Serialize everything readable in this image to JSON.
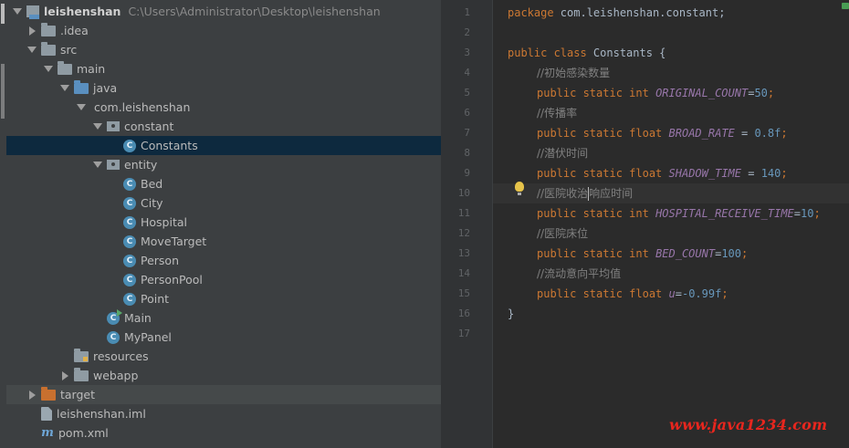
{
  "project_tree": {
    "rows": [
      {
        "label": "leishenshan",
        "path": "C:\\Users\\Administrator\\Desktop\\leishenshan",
        "icon": "module-icon"
      },
      {
        "label": ".idea",
        "icon": "folder-icon"
      },
      {
        "label": "src",
        "icon": "folder-icon"
      },
      {
        "label": "main",
        "icon": "folder-icon"
      },
      {
        "label": "java",
        "icon": "source-folder-icon"
      },
      {
        "label": "com.leishenshan",
        "icon": "package-icon"
      },
      {
        "label": "constant",
        "icon": "package-icon"
      },
      {
        "label": "Constants",
        "icon": "class-icon"
      },
      {
        "label": "entity",
        "icon": "package-icon"
      },
      {
        "label": "Bed",
        "icon": "class-icon"
      },
      {
        "label": "City",
        "icon": "class-icon"
      },
      {
        "label": "Hospital",
        "icon": "class-icon"
      },
      {
        "label": "MoveTarget",
        "icon": "class-icon"
      },
      {
        "label": "Person",
        "icon": "class-icon"
      },
      {
        "label": "PersonPool",
        "icon": "class-icon"
      },
      {
        "label": "Point",
        "icon": "class-icon"
      },
      {
        "label": "Main",
        "icon": "runnable-class-icon"
      },
      {
        "label": "MyPanel",
        "icon": "class-icon"
      },
      {
        "label": "resources",
        "icon": "resources-folder-icon"
      },
      {
        "label": "webapp",
        "icon": "folder-icon"
      },
      {
        "label": "target",
        "icon": "excluded-folder-icon"
      },
      {
        "label": "leishenshan.iml",
        "icon": "file-icon"
      },
      {
        "label": "pom.xml",
        "icon": "maven-icon"
      }
    ],
    "selected": "Constants",
    "class_icon_glyph": "C",
    "maven_icon_glyph": "m"
  },
  "editor": {
    "line_numbers": [
      "1",
      "2",
      "3",
      "4",
      "5",
      "6",
      "7",
      "8",
      "9",
      "10",
      "11",
      "12",
      "13",
      "14",
      "15",
      "16",
      "17"
    ],
    "current_line": "10",
    "code": {
      "l1_kw": "package",
      "l1_rest": " com.leishenshan.constant;",
      "l3_kw": "public class",
      "l3_rest": " Constants {",
      "l4_cm": "//初始感染数量",
      "l5_kw": "public static int",
      "l5_name": "ORIGINAL_COUNT",
      "l5_eq": "=",
      "l5_val": "50",
      "l5_end": ";",
      "l6_cm": "//传播率",
      "l7_kw": "public static float",
      "l7_name": "BROAD_RATE",
      "l7_eq": " = ",
      "l7_val": "0.8f",
      "l7_end": ";",
      "l8_cm": "//潜伏时间",
      "l9_kw": "public static float",
      "l9_name": "SHADOW_TIME",
      "l9_eq": " = ",
      "l9_val": "140",
      "l9_end": ";",
      "l10_cm_a": "//医院收治",
      "l10_cm_b": "响应时间",
      "l11_kw": "public static int",
      "l11_name": "HOSPITAL_RECEIVE_TIME",
      "l11_eq": "=",
      "l11_val": "10",
      "l11_end": ";",
      "l12_cm": "//医院床位",
      "l13_kw": "public static int",
      "l13_name": "BED_COUNT",
      "l13_eq": "=",
      "l13_val": "100",
      "l13_end": ";",
      "l14_cm": "//流动意向平均值",
      "l15_kw": "public static float",
      "l15_name": "u",
      "l15_eq": "=",
      "l15_val": "-0.99f",
      "l15_end": ";",
      "l16": "}"
    }
  },
  "watermark": "www.java1234.com",
  "colors": {
    "keyword": "#cc7832",
    "constant": "#9876aa",
    "number": "#6897bb",
    "comment": "#808080",
    "watermark": "#e8261e"
  }
}
